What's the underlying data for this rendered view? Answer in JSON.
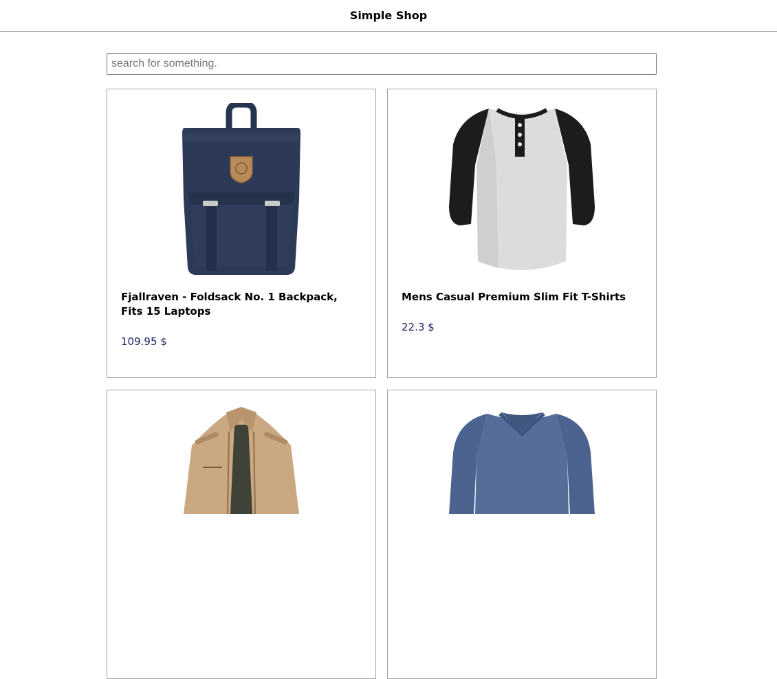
{
  "header": {
    "title": "Simple Shop"
  },
  "search": {
    "placeholder": "search for something."
  },
  "products": [
    {
      "name": "Fjallraven - Foldsack No. 1 Backpack, Fits 15 Laptops",
      "price": "109.95 $",
      "image_icon": "backpack-image"
    },
    {
      "name": "Mens Casual Premium Slim Fit T-Shirts",
      "price": "22.3 $",
      "image_icon": "raglan-tshirt-image"
    },
    {
      "name": "",
      "price": "",
      "image_icon": "jacket-image"
    },
    {
      "name": "",
      "price": "",
      "image_icon": "longsleeve-shirt-image"
    }
  ]
}
